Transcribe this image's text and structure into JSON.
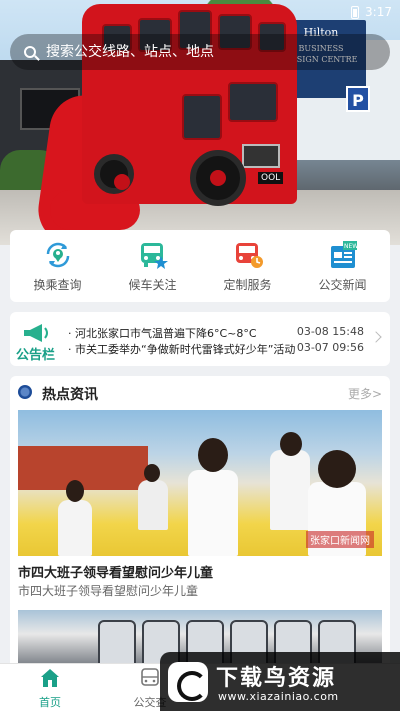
{
  "status_bar": {
    "time": "3:17"
  },
  "search": {
    "placeholder": "搜索公交线路、站点、地点"
  },
  "hero": {
    "hilton_text": "Hilton",
    "hilton_sub": "BUSINESS DESIGN CENTRE",
    "parking_sign": "P",
    "plate": "OOL"
  },
  "quick_menu": [
    {
      "label": "换乘查询",
      "icon": "transfer-query-icon"
    },
    {
      "label": "候车关注",
      "icon": "bus-wait-icon"
    },
    {
      "label": "定制服务",
      "icon": "custom-bus-icon"
    },
    {
      "label": "公交新闻",
      "icon": "news-icon"
    }
  ],
  "notice": {
    "title": "公告栏",
    "items": [
      {
        "text": "· 河北张家口市气温普遍下降6°C~8°C",
        "date": "03-08 15:48"
      },
      {
        "text": "· 市关工委举办“争做新时代雷锋式好少年”活动",
        "date": "03-07 09:56"
      }
    ]
  },
  "hot_news": {
    "title": "热点资讯",
    "more": "更多>",
    "articles": [
      {
        "title": "市四大班子领导看望慰问少年儿童",
        "summary": "市四大班子领导看望慰问少年儿童",
        "photo_watermark": "张家口新闻网"
      }
    ]
  },
  "bottom_nav": [
    {
      "label": "首页",
      "icon": "home-icon",
      "active": true
    },
    {
      "label": "公交查",
      "icon": "bus-icon",
      "active": false
    }
  ],
  "watermark": {
    "title": "下载鸟资源",
    "url": "www.xiazainiao.com"
  },
  "colors": {
    "accent": "#1aa088",
    "hero_bus": "#d2141c",
    "quick_icon": "#2f9ad8"
  }
}
